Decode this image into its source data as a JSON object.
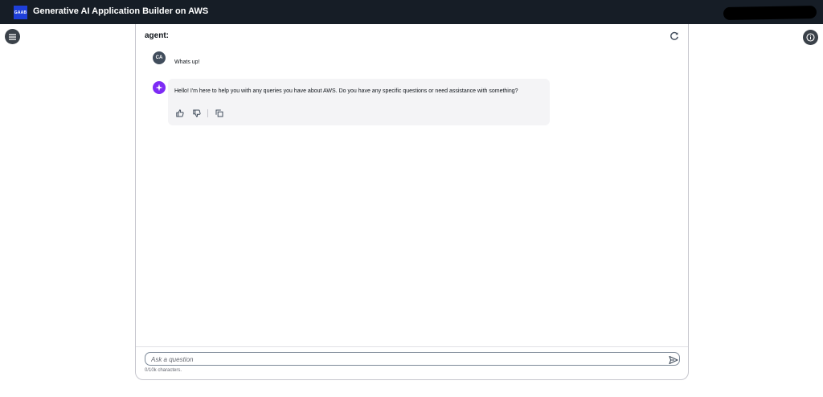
{
  "header": {
    "logo_text": "GAAB",
    "title": "Generative AI Application Builder on AWS"
  },
  "chat": {
    "title": "agent:",
    "user": {
      "initials": "CA",
      "message": "Whats up!"
    },
    "bot": {
      "message": "Hello! I'm here to help you with any queries you have about AWS. Do you have any specific questions or need assistance with something?"
    }
  },
  "composer": {
    "placeholder": "Ask a question",
    "value": "",
    "char_count": "0/10k characters."
  },
  "icons": {
    "menu": "hamburger-menu-icon",
    "info": "info-icon",
    "refresh": "refresh-icon",
    "bot_avatar": "sparkle-icon",
    "thumbs_up": "thumbs-up-icon",
    "thumbs_down": "thumbs-down-icon",
    "copy": "copy-icon",
    "send": "send-icon"
  },
  "colors": {
    "topbar": "#161d26",
    "logo_bg": "#1e3fd9",
    "bot_avatar": "#7d2bf5",
    "user_avatar": "#414d5c",
    "bubble": "#f4f4f6"
  }
}
